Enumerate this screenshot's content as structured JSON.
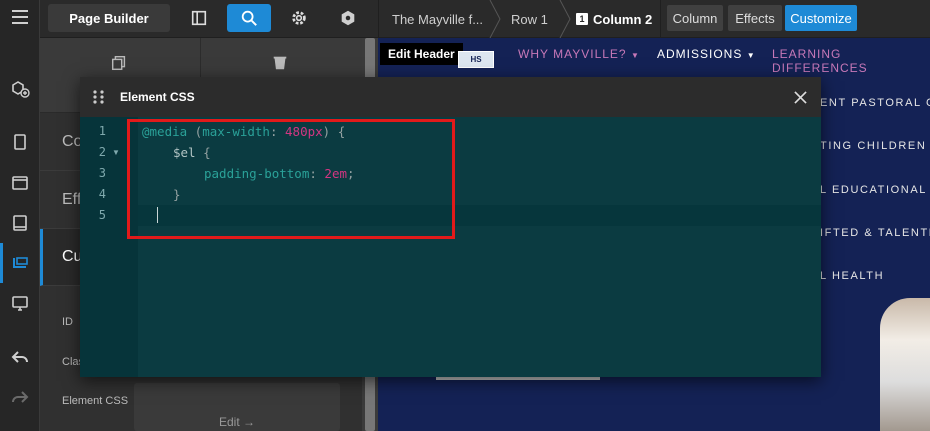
{
  "topbar": {
    "page_builder_label": "Page Builder",
    "breadcrumbs": [
      "The Mayville f...",
      "Row 1",
      "Column 2"
    ],
    "column_badge": "1",
    "tabs": [
      "Column",
      "Effects",
      "Customize"
    ]
  },
  "panel": {
    "rows": [
      "Co",
      "Eff",
      "Cu"
    ],
    "fields": {
      "id_label": "ID",
      "class_label": "Clas",
      "element_css_label": "Element CSS"
    },
    "edit_label": "Edit →"
  },
  "preview": {
    "edit_header_label": "Edit Header",
    "logo_text": "HS",
    "nav": [
      "WHY MAYVILLE?",
      "ADMISSIONS",
      "LEARNING DIFFERENCES"
    ],
    "menu_items": [
      "ENT PASTORAL CA",
      "TING CHILDREN &",
      "L EDUCATIONAL N",
      "IFTED & TALENTE",
      "L HEALTH"
    ]
  },
  "modal": {
    "title": "Element CSS",
    "line_numbers": [
      "1",
      "2",
      "3",
      "4",
      "5"
    ],
    "code": {
      "l1_at": "@media",
      "l1_open": " (",
      "l1_prop": "max-width",
      "l1_colon": ": ",
      "l1_num": "480px",
      "l1_close": ") {",
      "l2_var": "$el",
      "l2_brace": " {",
      "l3_prop": "padding-bottom",
      "l3_colon": ": ",
      "l3_num": "2em",
      "l3_semi": ";",
      "l4_brace": "}"
    }
  },
  "colors": {
    "accent": "#1e8ad6",
    "highlight": "#e11a1a",
    "editor_bg": "#0b3b41",
    "preview_bg": "#142255"
  }
}
